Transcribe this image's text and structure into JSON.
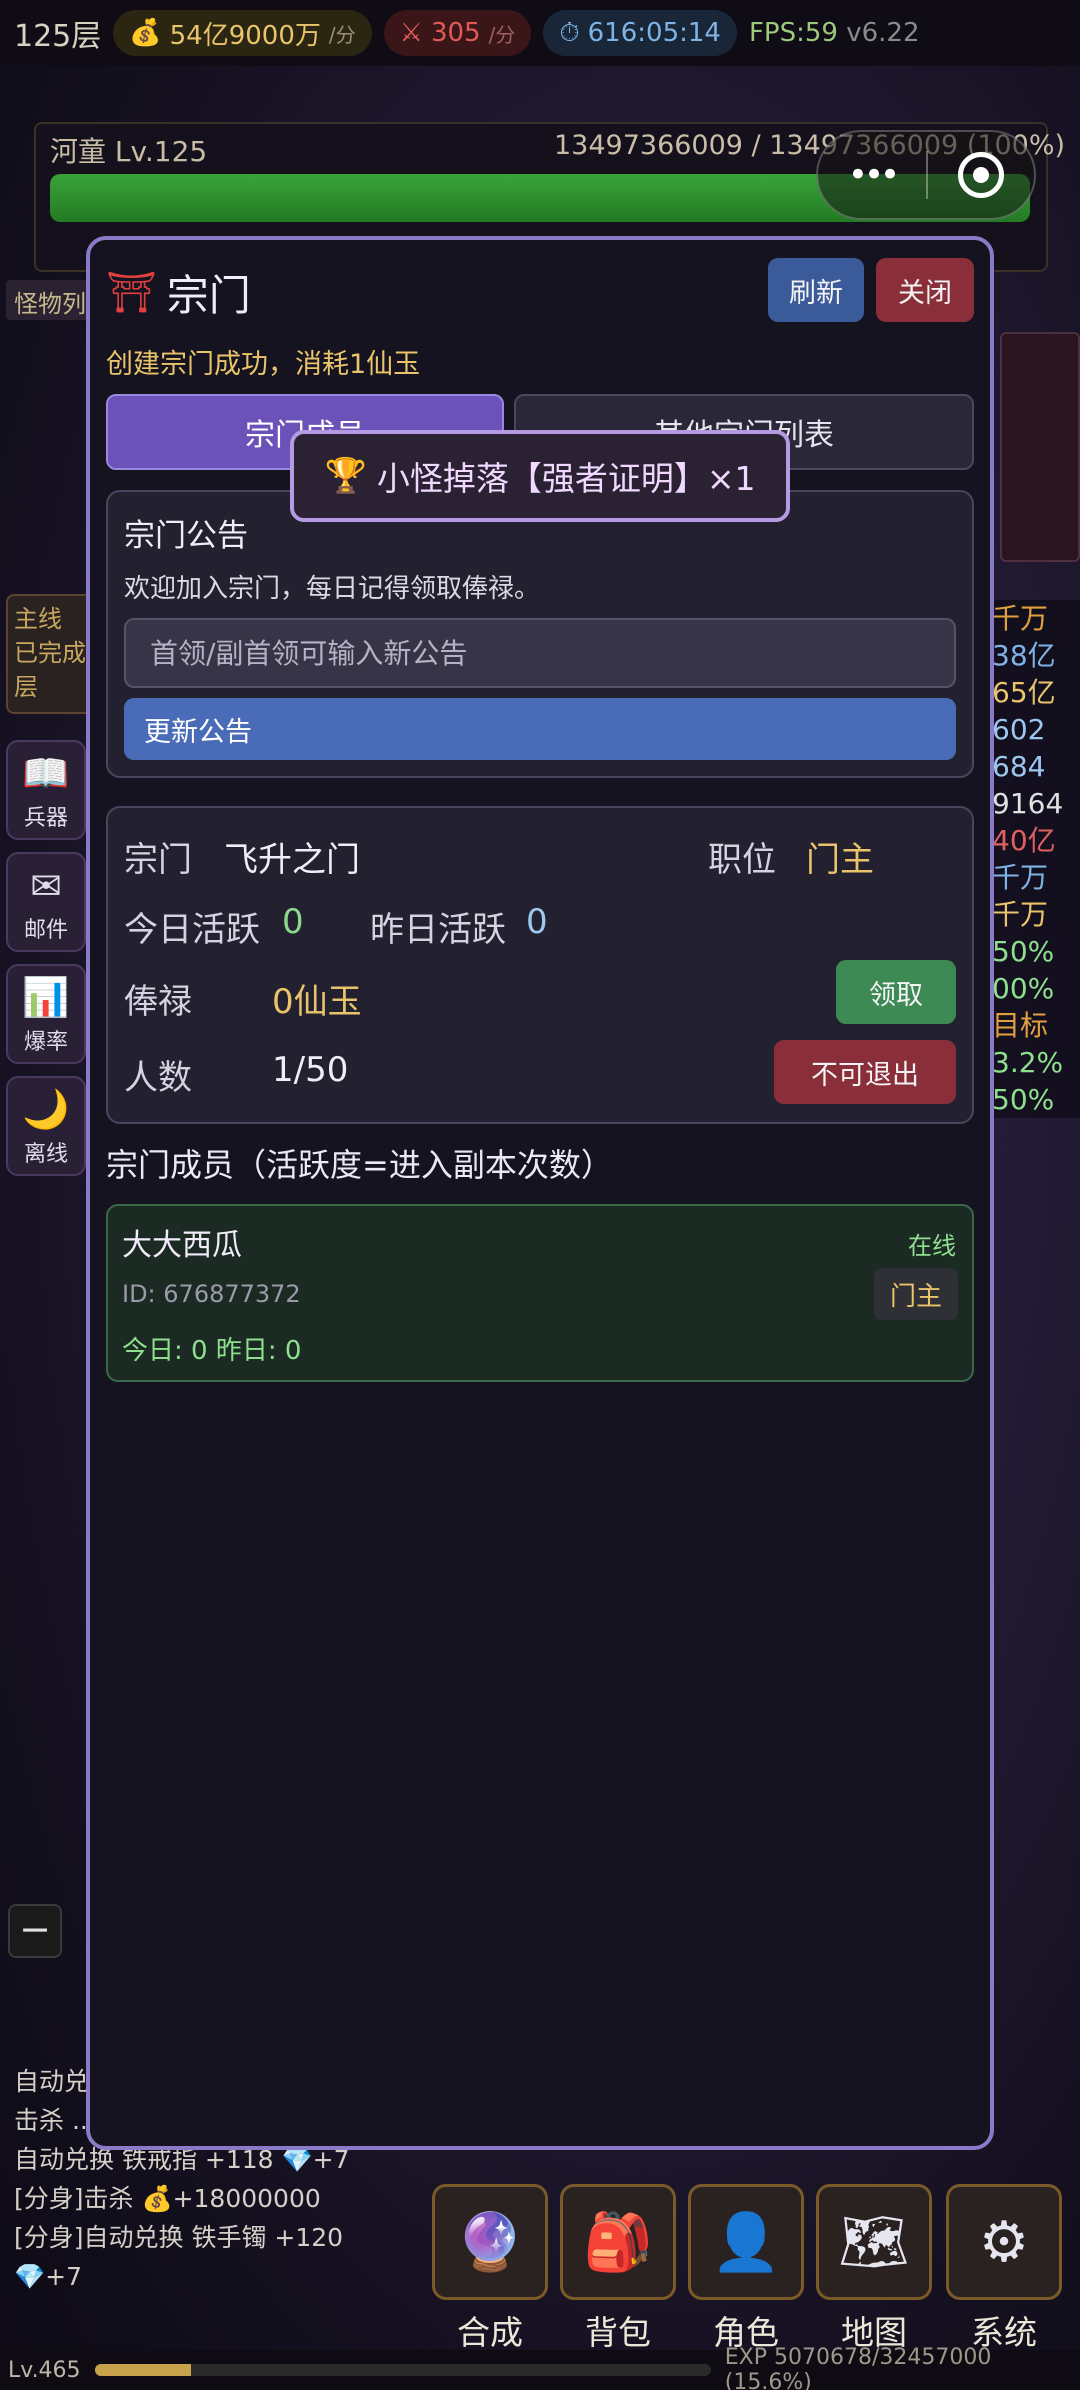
{
  "status": {
    "floor": "125层",
    "gold_rate": "54亿9000万",
    "gold_unit": "/分",
    "kill_rate": "305",
    "kill_unit": "/分",
    "timer": "616:05:14",
    "fps": "FPS:59",
    "version": "v6.22"
  },
  "boss": {
    "name": "河童 Lv.125",
    "hp": "13497366009 / 13497366009",
    "hp_percent": "(100%)",
    "hp_fraction": 1.0
  },
  "background_left": {
    "label": "怪物列",
    "items": [
      "兵器",
      "邮件",
      "爆率",
      "离线"
    ],
    "quest_text": "主线 已完成 层"
  },
  "background_right": {
    "stats": [
      "千万",
      "38亿",
      "65亿",
      "602",
      "684",
      "9164",
      "40亿",
      "千万",
      "千万",
      "50%",
      "00%",
      "目标",
      "3.2%",
      "50%"
    ]
  },
  "log": [
    "自动兑换 ...",
    "击杀 ...",
    "自动兑换 铁戒指 +118 💎+7",
    "[分身]击杀 💰+18000000",
    "[分身]自动兑换 铁手镯 +120",
    "💎+7"
  ],
  "nav": {
    "items": [
      {
        "label": "合成",
        "icon": "crystal-ball-icon"
      },
      {
        "label": "背包",
        "icon": "backpack-icon"
      },
      {
        "label": "角色",
        "icon": "person-icon"
      },
      {
        "label": "地图",
        "icon": "map-icon"
      },
      {
        "label": "系统",
        "icon": "gear-icon"
      }
    ]
  },
  "level_bar": {
    "level": "Lv.465",
    "exp": "EXP 5070678/32457000 (15.6%)",
    "exp_fraction": 0.156
  },
  "modal": {
    "title": "宗门",
    "refresh_label": "刷新",
    "close_label": "关闭",
    "notice": "创建宗门成功，消耗1仙玉",
    "tabs": [
      "宗门成员",
      "其他宗门列表"
    ],
    "toast": "小怪掉落【强者证明】×1",
    "announcement": {
      "title": "宗门公告",
      "text": "欢迎加入宗门，每日记得领取俸禄。",
      "placeholder": "首领/副首领可输入新公告",
      "update_label": "更新公告"
    },
    "sect": {
      "name_label": "宗门",
      "name": "飞升之门",
      "position_label": "职位",
      "position": "门主",
      "today_label": "今日活跃",
      "today": "0",
      "yesterday_label": "昨日活跃",
      "yesterday": "0",
      "salary_label": "俸禄",
      "salary": "0仙玉",
      "claim_label": "领取",
      "count_label": "人数",
      "count": "1/50",
      "no_exit_label": "不可退出"
    },
    "members_title": "宗门成员（活跃度=进入副本次数）",
    "members": [
      {
        "name": "大大西瓜",
        "status": "在线",
        "id": "ID: 676877372",
        "role": "门主",
        "activity": "今日: 0    昨日: 0"
      }
    ]
  },
  "colors": {
    "modal_border": "#8a7ac8",
    "tab_active": "#6b52b8",
    "gold": "#e9c46a",
    "claim_green": "#3d8a55",
    "danger_red": "#8a2f3a",
    "refresh_blue": "#3b5a9a"
  }
}
